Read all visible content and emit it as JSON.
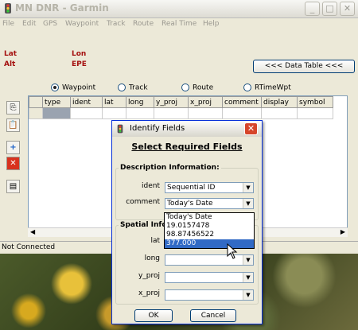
{
  "window": {
    "title": "MN DNR - Garmin",
    "menu": [
      "File",
      "Edit",
      "GPS",
      "Waypoint",
      "Track",
      "Route",
      "Real Time",
      "Help"
    ]
  },
  "readouts": {
    "lat": "Lat",
    "lon": "Lon",
    "alt": "Alt",
    "epe": "EPE"
  },
  "data_table_button": "<<< Data Table <<<",
  "radio_options": [
    {
      "label": "Waypoint",
      "selected": true
    },
    {
      "label": "Track",
      "selected": false
    },
    {
      "label": "Route",
      "selected": false
    },
    {
      "label": "RTimeWpt",
      "selected": false
    }
  ],
  "grid_columns": [
    "type",
    "ident",
    "lat",
    "long",
    "y_proj",
    "x_proj",
    "comment",
    "display",
    "symbol"
  ],
  "status": "Not Connected",
  "dialog": {
    "title": "Identify Fields",
    "heading": "Select Required Fields",
    "description_group": "Description Information:",
    "spatial_group": "Spatial Info",
    "fields": {
      "ident": {
        "label": "ident",
        "value": "Sequential ID"
      },
      "comment": {
        "label": "comment",
        "value": "Today's Date"
      },
      "lat": {
        "label": "lat",
        "value": ""
      },
      "long": {
        "label": "long",
        "value": ""
      },
      "y_proj": {
        "label": "y_proj",
        "value": ""
      },
      "x_proj": {
        "label": "x_proj",
        "value": ""
      }
    },
    "dropdown_options": [
      "Today's Date",
      "19.0157478",
      "98.87456522",
      "377.000"
    ],
    "dropdown_selected": "377.000",
    "ok_label": "OK",
    "cancel_label": "Cancel"
  },
  "colors": {
    "readout_red": "#a4100f",
    "selection_blue": "#316ac5",
    "close_red": "#d6452a"
  }
}
